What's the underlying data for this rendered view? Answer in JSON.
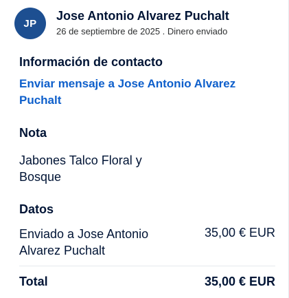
{
  "header": {
    "avatar_initials": "JP",
    "name": "Jose Antonio Alvarez Puchalt",
    "subline": "26 de septiembre de 2025 . Dinero enviado"
  },
  "contact": {
    "title": "Información de contacto",
    "link": "Enviar mensaje a Jose Antonio Alvarez Puchalt"
  },
  "note": {
    "title": "Nota",
    "text": "Jabones Talco Floral y Bosque"
  },
  "details": {
    "title": "Datos",
    "sent_label": "Enviado a Jose Antonio Alvarez Puchalt",
    "sent_amount": "35,00 € EUR"
  },
  "total": {
    "label": "Total",
    "amount": "35,00 € EUR"
  },
  "colors": {
    "avatar_bg": "#1d4f91",
    "link": "#0e5fcb",
    "text": "#001435"
  }
}
